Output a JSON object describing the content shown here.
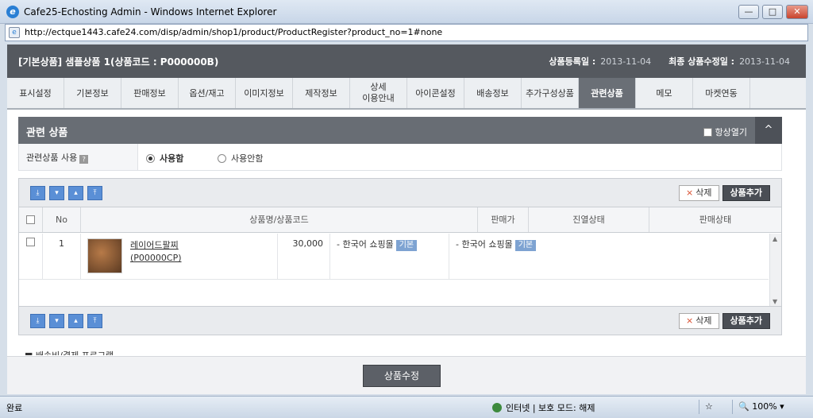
{
  "window": {
    "title": "Cafe25-Echosting Admin - Windows Internet Explorer",
    "minimize": "—",
    "maximize": "□",
    "close": "✕",
    "address": "http://ectque1443.cafe24.com/disp/admin/shop1/product/ProductRegister?product_no=1#none"
  },
  "page_header": {
    "product_title": "[기본상품] 샘플상품 1(상품코드 : P000000B)",
    "reg_label": "상품등록일 :",
    "reg_date": "2013-11-04",
    "mod_label": "최종 상품수정일 :",
    "mod_date": "2013-11-04"
  },
  "tabs": [
    {
      "label": "표시설정"
    },
    {
      "label": "기본정보"
    },
    {
      "label": "판매정보"
    },
    {
      "label": "옵션/재고"
    },
    {
      "label": "이미지정보"
    },
    {
      "label": "제작정보"
    },
    {
      "label": "상세\n이용안내"
    },
    {
      "label": "아이콘설정"
    },
    {
      "label": "배송정보"
    },
    {
      "label": "추가구성상품"
    },
    {
      "label": "관련상품",
      "active": true
    },
    {
      "label": "메모"
    },
    {
      "label": "마켓연동"
    }
  ],
  "section": {
    "title": "관련 상품",
    "always_open": "항상열기",
    "collapse_icon": "^",
    "use_label": "관련상품 사용",
    "help_icon": "?",
    "option_use": "사용함",
    "option_nouse": "사용안함",
    "selected": "사용함"
  },
  "toolbar": {
    "move_buttons": [
      "⤓",
      "▾",
      "▴",
      "⤒"
    ],
    "delete_x": "×",
    "delete_label": "삭제",
    "add_label": "상품추가"
  },
  "table": {
    "columns": [
      "No",
      "상품명/상품코드",
      "판매가",
      "진열상태",
      "판매상태"
    ],
    "rows": [
      {
        "no": "1",
        "name": "레이어드팔찌",
        "code": "(P00000CP)",
        "price": "30,000",
        "display_status": "- 한국어 쇼핑몰",
        "display_badge": "기본",
        "sale_status": "- 한국어 쇼핑몰",
        "sale_badge": "기본"
      }
    ]
  },
  "submit_label": "상품수정",
  "cut_text": "■ 배송비/결제 프로그램",
  "statusbar": {
    "left": "완료",
    "zone": "인터넷 | 보호 모드: 해제",
    "zoom": "100%",
    "fav_icon": "☆"
  }
}
